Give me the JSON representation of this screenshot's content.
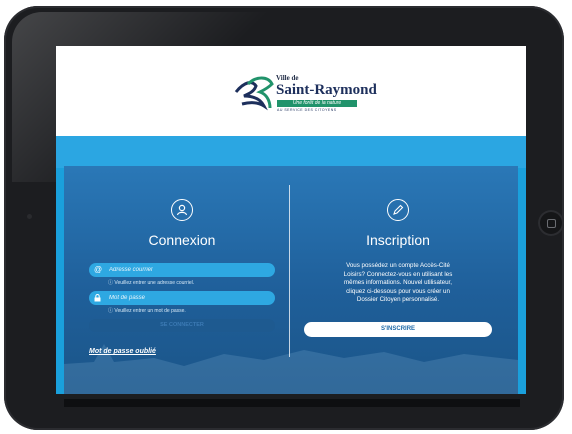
{
  "brand": {
    "ville_de": "Ville de",
    "name": "Saint-Raymond",
    "slogan": "Une forêt de la nature",
    "sub": "AU SERVICE DES CITOYENS"
  },
  "login": {
    "title": "Connexion",
    "email_placeholder": "Adresse courriel",
    "email_hint": "ⓘ Veuillez entrer une adresse courriel.",
    "password_placeholder": "Mot de passe",
    "password_hint": "ⓘ Veuillez entrer un mot de passe.",
    "submit_label": "SE CONNECTER",
    "forgot_label": "Mot de passe oublié"
  },
  "signup": {
    "title": "Inscription",
    "description": "Vous possédez un compte Accès-Cité Loisirs? Connectez-vous en utilisant les mêmes informations. Nouvel utilisateur, cliquez ci-dessous pour vous créer un Dossier Citoyen personnalisé.",
    "button_label": "S'INSCRIRE"
  },
  "icons": {
    "user": "user-icon",
    "pencil": "pencil-icon",
    "at": "at-icon",
    "lock": "lock-icon"
  },
  "colors": {
    "panel": "#1f5f9a",
    "accent": "#2ea8e2",
    "header": "#ffffff",
    "brand_navy": "#1d2f5c",
    "brand_green": "#21936b"
  }
}
